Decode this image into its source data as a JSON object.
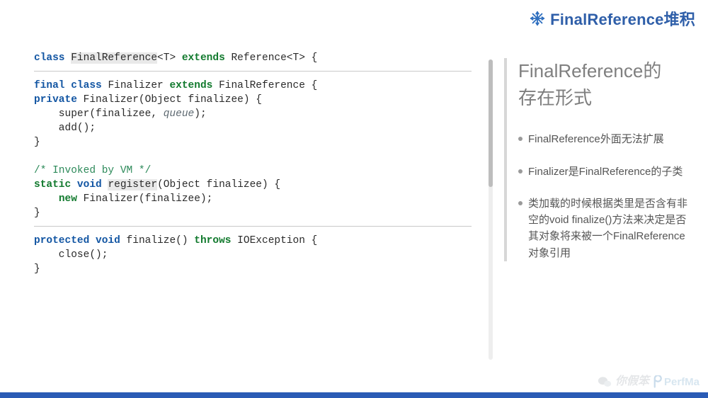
{
  "header": {
    "title": "FinalReference堆积"
  },
  "code": {
    "block1": {
      "t1": "class ",
      "hi1": "FinalReference",
      "t2": "<T> ",
      "kwExtends": "extends",
      "t3": " Reference<T> {"
    },
    "block2": {
      "l1a": "final",
      "l1b": " class ",
      "l1c": "Finalizer ",
      "l1d": "extends",
      "l1e": " FinalReference {",
      "l2a": "private",
      "l2b": " Finalizer(Object finalizee) {",
      "l3a": "    super(finalizee, ",
      "l3b": "queue",
      "l3c": ");",
      "l4": "    add();",
      "l5": "}",
      "gap": "",
      "c1": "/* Invoked by VM */",
      "l6a": "static",
      "l6b": " ",
      "l6c": "void",
      "l6d": " ",
      "l6e": "register",
      "l6f": "(Object finalizee) {",
      "l7a": "    ",
      "l7b": "new",
      "l7c": " Finalizer(finalizee);",
      "l8": "}"
    },
    "block3": {
      "l1a": "protected",
      "l1b": " ",
      "l1c": "void",
      "l1d": " finalize() ",
      "l1e": "throws",
      "l1f": " IOException {",
      "l2": "    close();",
      "l3": "}"
    }
  },
  "right": {
    "heading_l1": "FinalReference的",
    "heading_l2": "存在形式",
    "bullets": [
      "FinalReference外面无法扩展",
      "Finalizer是FinalReference的子类",
      "类加载的时候根据类里是否含有非空的void finalize()方法来决定是否其对象将来被一个FinalReference对象引用"
    ]
  },
  "watermark": {
    "text": "你假笨",
    "logo": "PerfMa"
  }
}
